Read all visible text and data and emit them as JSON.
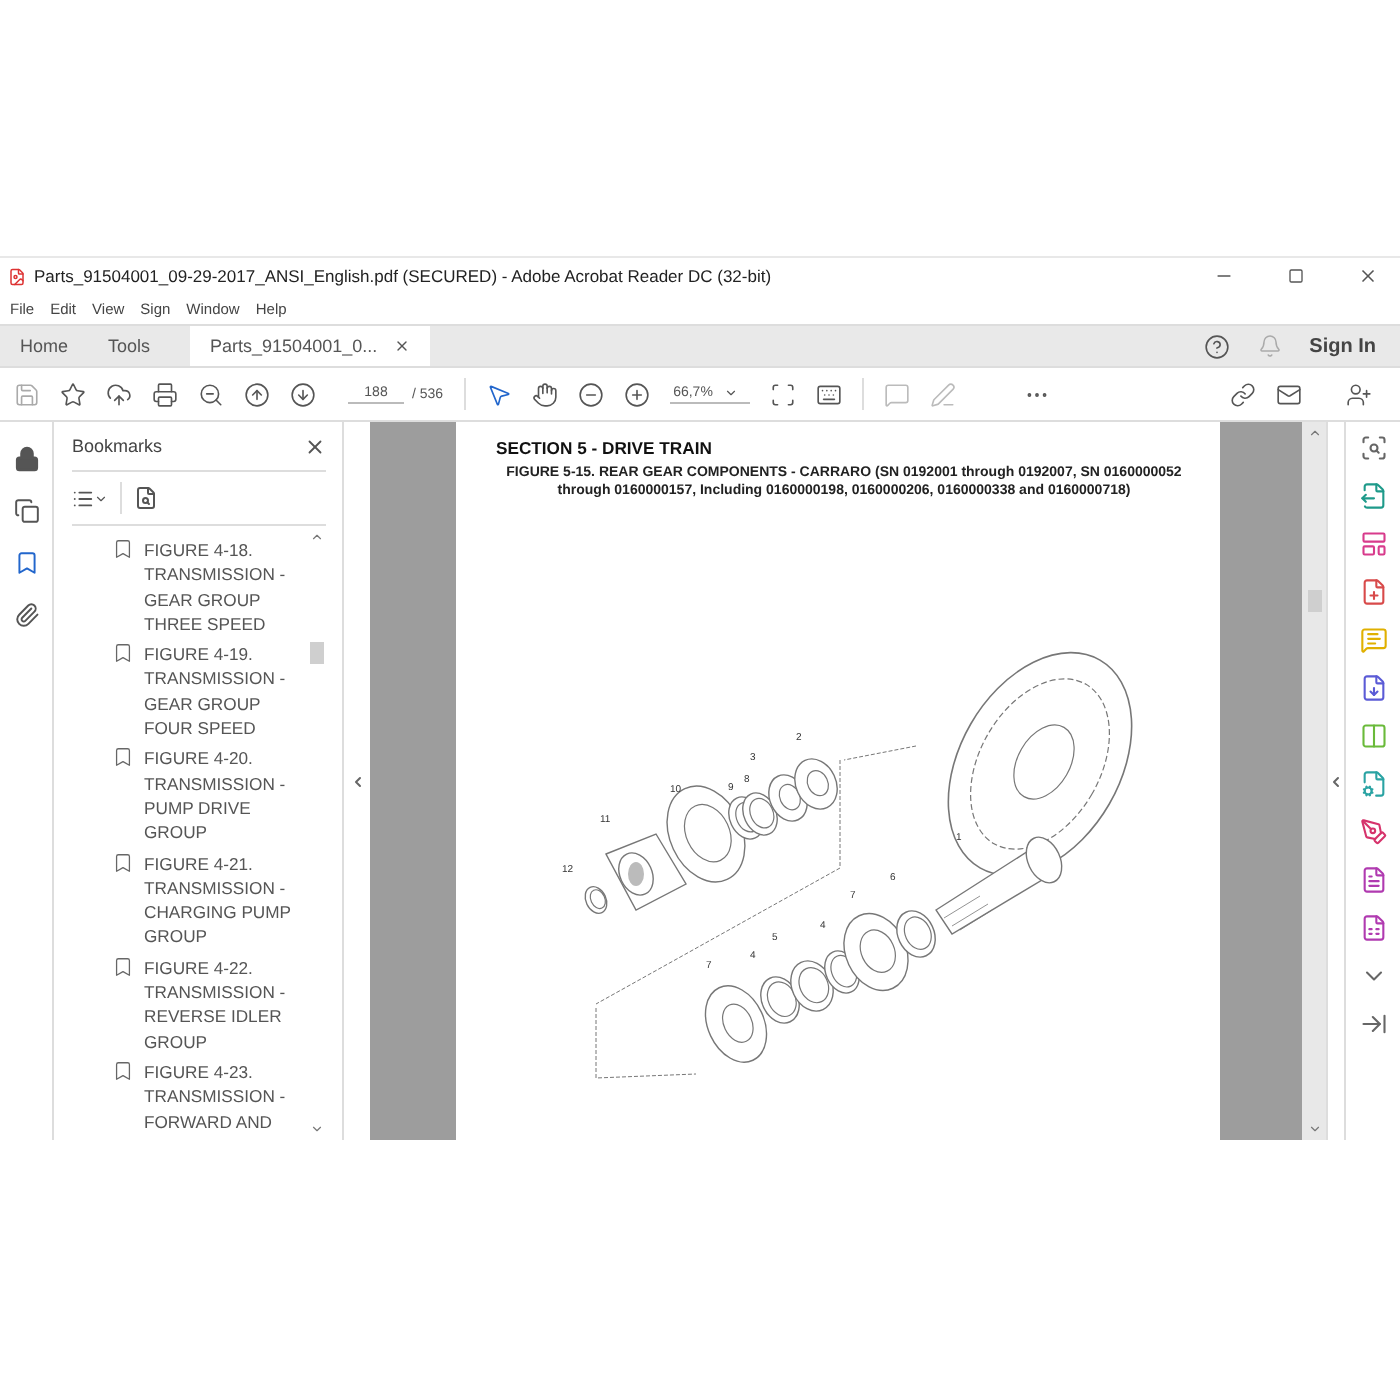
{
  "window": {
    "title": "Parts_91504001_09-29-2017_ANSI_English.pdf (SECURED) - Adobe Acrobat Reader DC (32-bit)"
  },
  "menu": [
    "File",
    "Edit",
    "View",
    "Sign",
    "Window",
    "Help"
  ],
  "tabs": [
    {
      "label": "Home",
      "selected": false
    },
    {
      "label": "Tools",
      "selected": false
    },
    {
      "label": "Parts_91504001_0...",
      "selected": true
    }
  ],
  "sign_in": "Sign In",
  "toolbar": {
    "page": "188",
    "page_count": "/ 536",
    "zoom": "66,7%"
  },
  "left_rail": [
    {
      "selected": false
    },
    {
      "selected": false
    },
    {
      "selected": true
    },
    {
      "selected": false
    }
  ],
  "bookmarks": {
    "title": "Bookmarks",
    "items": [
      {
        "label": "FIGURE 4-18. TRANSMISSION - GEAR GROUP THREE SPEED"
      },
      {
        "label": "FIGURE 4-19. TRANSMISSION - GEAR GROUP FOUR SPEED"
      },
      {
        "label": "FIGURE 4-20. TRANSMISSION - PUMP DRIVE GROUP"
      },
      {
        "label": "FIGURE 4-21. TRANSMISSION - CHARGING PUMP GROUP"
      },
      {
        "label": "FIGURE 4-22. TRANSMISSION - REVERSE IDLER GROUP"
      },
      {
        "label": "FIGURE 4-23. TRANSMISSION - FORWARD AND"
      }
    ]
  },
  "document": {
    "section": "SECTION 5 - DRIVE TRAIN",
    "caption": "FIGURE 5-15. REAR GEAR COMPONENTS - CARRARO (SN 0192001 through 0192007, SN 0160000052 through 0160000157, Including 0160000198, 0160000206, 0160000338 and 0160000718)",
    "callouts": [
      "2",
      "3",
      "8",
      "9",
      "10",
      "11",
      "12",
      "1",
      "6",
      "7",
      "4",
      "5",
      "4",
      "7"
    ]
  }
}
